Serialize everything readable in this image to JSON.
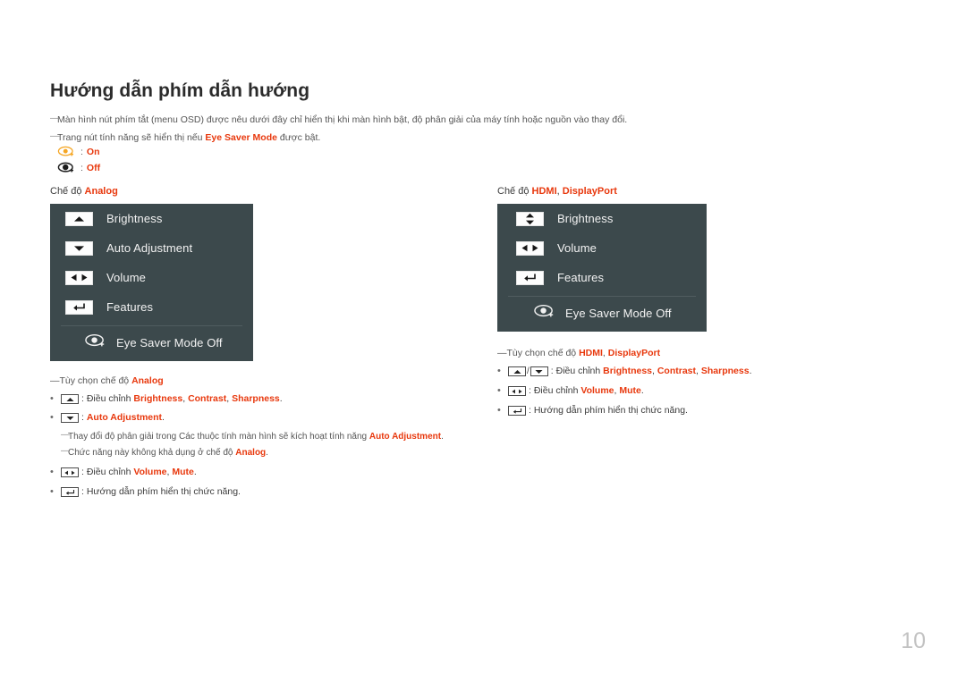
{
  "page": {
    "title": "Hướng dẫn phím dẫn hướng",
    "page_number": "10",
    "accent_color": "#e8380d",
    "osd_background": "#3c494c",
    "osd_text_color": "#f2f2f2"
  },
  "notes": {
    "note1": "Màn hình nút phím tắt (menu OSD) được nêu dưới đây chỉ hiển thị khi màn hình bật, độ phân giải của máy tính hoặc nguồn vào thay đổi.",
    "note2_before": "Trang nút tính năng sẽ hiển thị nếu ",
    "note2_term": "Eye Saver Mode",
    "note2_after": " được bật."
  },
  "legend": {
    "on": {
      "icon": "eye-saver-on-icon",
      "label": "On",
      "separator": ":"
    },
    "off": {
      "icon": "eye-saver-off-icon",
      "label": "Off",
      "separator": ":"
    }
  },
  "left_panel": {
    "caption_prefix": "Chế độ ",
    "caption_mode": "Analog",
    "rows": [
      {
        "icon": "up-arrow-key-icon",
        "label": "Brightness"
      },
      {
        "icon": "down-arrow-key-icon",
        "label": "Auto Adjustment"
      },
      {
        "icon": "left-right-arrow-key-icon",
        "label": "Volume"
      },
      {
        "icon": "enter-key-icon",
        "label": "Features"
      }
    ],
    "eye_row": {
      "icon": "eye-saver-mode-icon",
      "label": "Eye Saver Mode Off"
    }
  },
  "right_panel": {
    "caption_prefix": "Chế độ ",
    "caption_mode_1": "HDMI",
    "caption_mode_sep": ", ",
    "caption_mode_2": "DisplayPort",
    "rows": [
      {
        "icon": "up-down-arrow-key-icon",
        "label": "Brightness"
      },
      {
        "icon": "left-right-arrow-key-icon",
        "label": "Volume"
      },
      {
        "icon": "enter-key-icon",
        "label": "Features"
      }
    ],
    "eye_row": {
      "icon": "eye-saver-mode-icon",
      "label": "Eye Saver Mode Off"
    }
  },
  "left_options": {
    "heading_prefix": "Tùy chọn chế độ ",
    "heading_mode": "Analog",
    "b1": {
      "key": "up-arrow-key-icon",
      "colon": ": ",
      "text": "Điều chỉnh ",
      "t1": "Brightness",
      "s1": ", ",
      "t2": "Contrast",
      "s2": ", ",
      "t3": "Sharpness",
      "end": "."
    },
    "b2": {
      "key": "down-arrow-key-icon",
      "colon": ": ",
      "t1": "Auto Adjustment",
      "end": "."
    },
    "n1_a": "Thay đổi độ phân giải trong Các thuộc tính màn hình sẽ kích hoạt tính năng ",
    "n1_t": "Auto Adjustment",
    "n1_b": ".",
    "n2_a": "Chức năng này không khả dụng ở chế độ ",
    "n2_t": "Analog",
    "n2_b": ".",
    "b3": {
      "key": "left-right-arrow-key-icon",
      "colon": ": ",
      "text": "Điều chỉnh ",
      "t1": "Volume",
      "s1": ", ",
      "t2": "Mute",
      "end": "."
    },
    "b4": {
      "key": "enter-key-icon",
      "colon": ": ",
      "text": "Hướng dẫn phím hiển thị chức năng."
    }
  },
  "right_options": {
    "heading_prefix": "Tùy chọn chế độ ",
    "heading_mode_1": "HDMI",
    "heading_mode_sep": ", ",
    "heading_mode_2": "DisplayPort",
    "b1": {
      "key1": "up-arrow-key-icon",
      "slash": "/",
      "key2": "down-arrow-key-icon",
      "colon": ": ",
      "text": "Điều chỉnh ",
      "t1": "Brightness",
      "s1": ", ",
      "t2": "Contrast",
      "s2": ", ",
      "t3": "Sharpness",
      "end": "."
    },
    "b2": {
      "key": "left-right-arrow-key-icon",
      "colon": ": ",
      "text": "Điều chỉnh ",
      "t1": "Volume",
      "s1": ", ",
      "t2": "Mute",
      "end": "."
    },
    "b3": {
      "key": "enter-key-icon",
      "colon": ": ",
      "text": "Hướng dẫn phím hiển thị chức năng."
    }
  }
}
